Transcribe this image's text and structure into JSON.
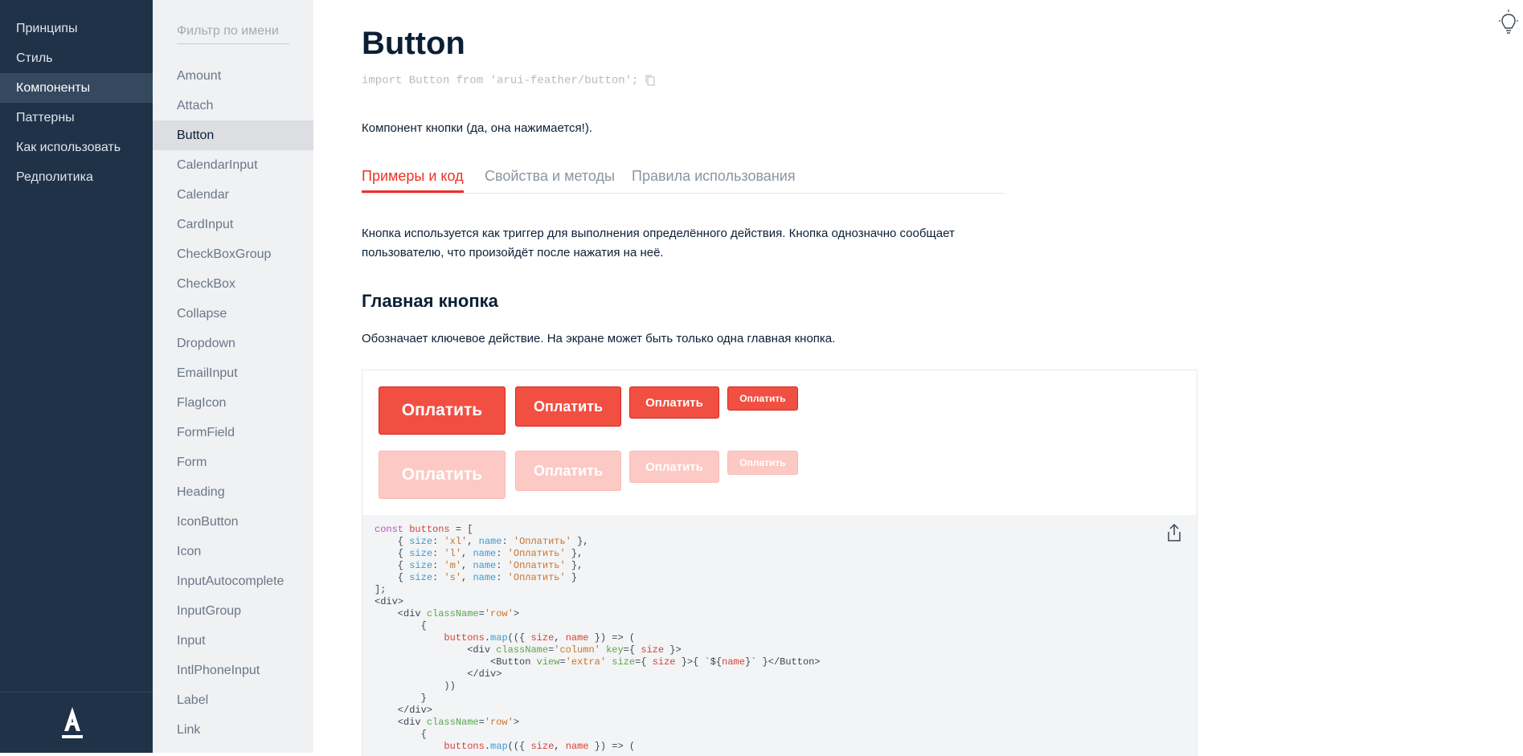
{
  "nav": {
    "items": [
      "Принципы",
      "Стиль",
      "Компоненты",
      "Паттерны",
      "Как использовать",
      "Редполитика"
    ],
    "active_index": 2,
    "logo": "А"
  },
  "components": {
    "filter_placeholder": "Фильтр по имени",
    "items": [
      "Amount",
      "Attach",
      "Button",
      "CalendarInput",
      "Calendar",
      "CardInput",
      "CheckBoxGroup",
      "CheckBox",
      "Collapse",
      "Dropdown",
      "EmailInput",
      "FlagIcon",
      "FormField",
      "Form",
      "Heading",
      "IconButton",
      "Icon",
      "InputAutocomplete",
      "InputGroup",
      "Input",
      "IntlPhoneInput",
      "Label",
      "Link"
    ],
    "active_index": 2
  },
  "page": {
    "title": "Button",
    "import_line": "import Button from 'arui-feather/button';",
    "description": "Компонент кнопки (да, она нажимается!).",
    "tabs": [
      "Примеры и код",
      "Свойства и методы",
      "Правила использования"
    ],
    "active_tab": 0,
    "intro": "Кнопка используется как триггер для выполнения определённого действия. Кнопка однозначно сообщает пользователю, что произойдёт после нажатия на неё.",
    "section_title": "Главная кнопка",
    "section_desc": "Обозначает ключевое действие. На экране может быть только одна главная кнопка.",
    "button_label": "Оплатить",
    "accent_color": "#ef3124"
  },
  "icons": {
    "copy": "copy-icon",
    "share": "share-icon",
    "bulb": "lightbulb-icon"
  }
}
